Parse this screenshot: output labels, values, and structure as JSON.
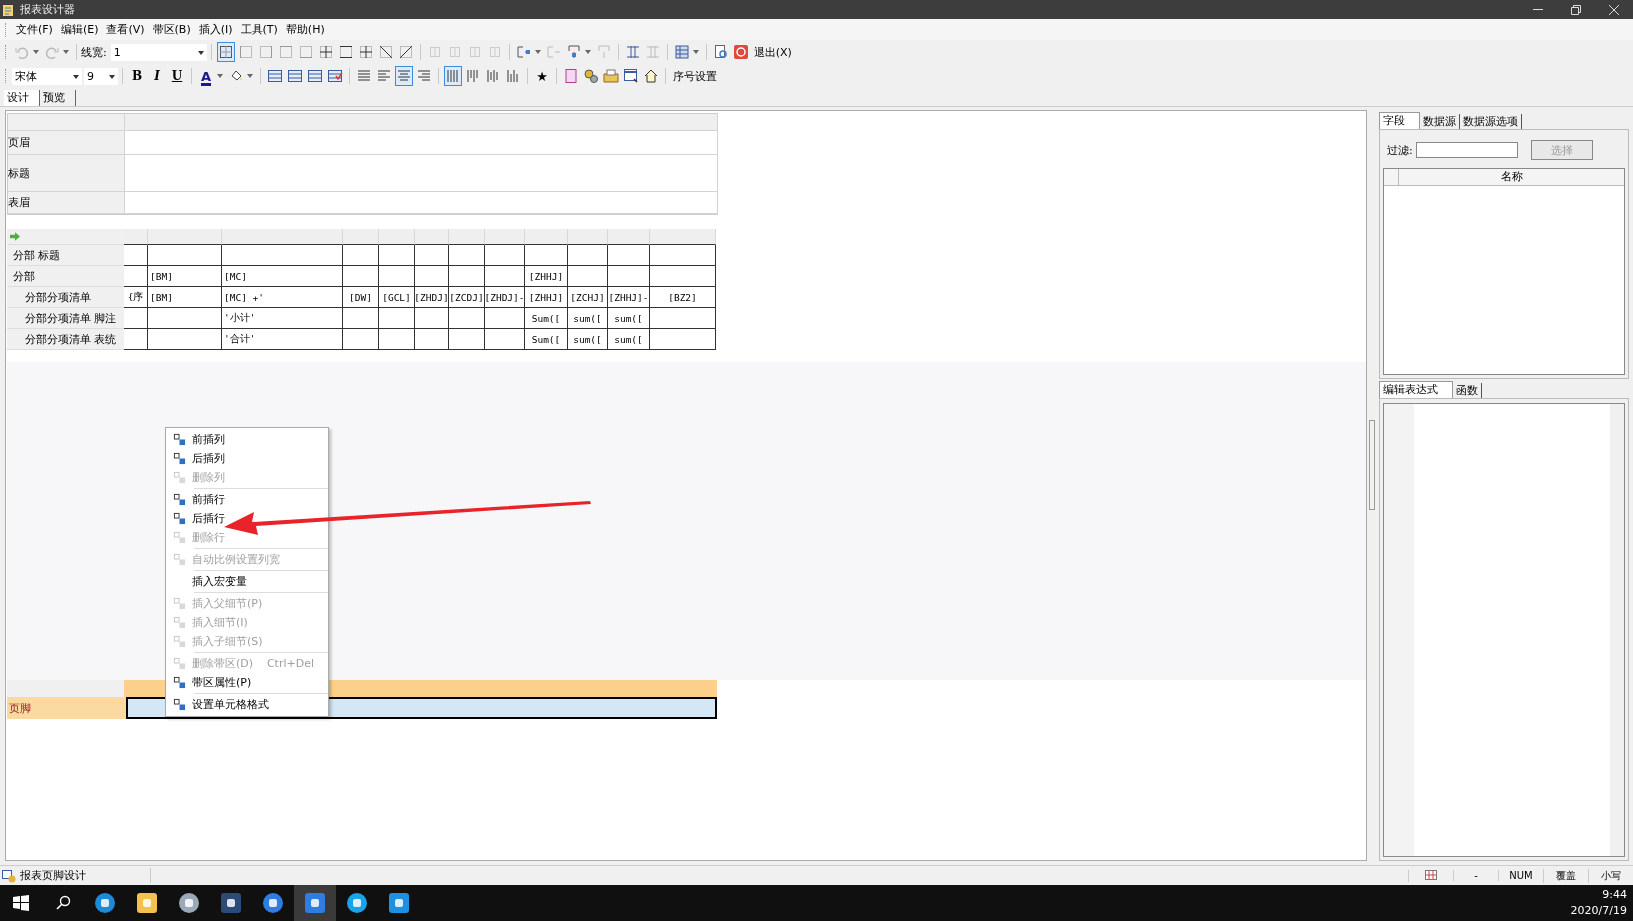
{
  "window": {
    "title": "报表设计器"
  },
  "menu": [
    "文件(F)",
    "编辑(E)",
    "查看(V)",
    "带区(B)",
    "插入(I)",
    "工具(T)",
    "帮助(H)"
  ],
  "toolbar_1": {
    "line_width": {
      "label": "线宽:",
      "value": "1"
    },
    "border_buttons": [
      {
        "selected": true
      },
      {
        "selected": false
      },
      {
        "selected": false
      },
      {
        "selected": false
      },
      {
        "selected": false
      },
      {
        "selected": false
      },
      {
        "selected": false
      },
      {
        "selected": false
      },
      {
        "selected": false
      },
      {
        "selected": false
      }
    ],
    "exit_button": "退出(X)"
  },
  "toolbar_2": {
    "font": "宋体",
    "size": "9",
    "format_buttons": [
      "B",
      "I",
      "U"
    ],
    "font_color_button": "A",
    "align_buttons": [
      {
        "selected": false
      },
      {
        "selected": false
      },
      {
        "selected": true
      },
      {
        "selected": false
      }
    ],
    "valign_buttons": [
      {
        "selected": true
      },
      {
        "selected": false
      },
      {
        "selected": false
      },
      {
        "selected": false
      }
    ],
    "star_button": "★",
    "sequence_button": "序号设置"
  },
  "view_tabs": [
    {
      "label": "设计",
      "selected": true
    },
    {
      "label": "预览",
      "selected": false
    }
  ],
  "top_bands": [
    {
      "label": "页眉"
    },
    {
      "label": "标题"
    },
    {
      "label": "表眉"
    }
  ],
  "detail_bands": [
    {
      "label": "分部 标题",
      "cells": [
        null,
        null,
        null,
        null,
        null,
        null,
        null,
        null,
        null,
        null,
        null,
        null
      ]
    },
    {
      "label": "分部",
      "cells": [
        null,
        "[BM]",
        "[MC]",
        null,
        null,
        null,
        null,
        null,
        "[ZHHJ]",
        null,
        null,
        null
      ],
      "children": [
        {
          "label": "分部分项清单",
          "cells": [
            "{序",
            "[BM]",
            "[MC] +'",
            "[DW]",
            "[GCL]",
            "[ZHDJ]",
            "[ZCDJ]",
            "[ZHDJ]-",
            "[ZHHJ]",
            "[ZCHJ]",
            "[ZHHJ]-",
            "[BZ2]"
          ]
        },
        {
          "label": "分部分项清单 脚注",
          "cells": [
            null,
            null,
            "'小计'",
            null,
            null,
            null,
            null,
            null,
            "Sum([",
            "sum([",
            "sum([",
            null
          ]
        },
        {
          "label": "分部分项清单 表统",
          "cells": [
            null,
            null,
            "'合计'",
            null,
            null,
            null,
            null,
            null,
            "Sum([",
            "sum([",
            "sum([",
            null
          ]
        }
      ]
    }
  ],
  "footer_band": {
    "label": "页脚",
    "selected": true
  },
  "context_menu": {
    "groups": [
      [
        {
          "kind": "icon",
          "label": "前插列",
          "disabled": false
        },
        {
          "kind": "icon",
          "label": "后插列",
          "disabled": false
        },
        {
          "kind": "icon",
          "label": "删除列",
          "disabled": true
        }
      ],
      [
        {
          "kind": "icon",
          "label": "前插行",
          "disabled": false
        },
        {
          "kind": "icon",
          "label": "后插行",
          "disabled": false
        },
        {
          "kind": "icon",
          "label": "删除行",
          "disabled": true
        }
      ],
      [
        {
          "kind": "icon",
          "label": "自动比例设置列宽",
          "disabled": true
        }
      ],
      [
        {
          "kind": "text",
          "label": "插入宏变量",
          "disabled": false
        }
      ],
      [
        {
          "kind": "icon",
          "label": "插入父细节(P)",
          "disabled": true
        },
        {
          "kind": "icon",
          "label": "插入细节(I)",
          "disabled": true
        },
        {
          "kind": "icon",
          "label": "插入子细节(S)",
          "disabled": true
        }
      ],
      [
        {
          "kind": "icon",
          "label": "删除带区(D)",
          "shortcut": "Ctrl+Del",
          "disabled": true
        },
        {
          "kind": "icon",
          "label": "带区属性(P)",
          "disabled": false
        }
      ],
      [
        {
          "kind": "icon",
          "label": "设置单元格格式",
          "disabled": false
        }
      ]
    ]
  },
  "right_panel": {
    "tabs": [
      {
        "label": "字段",
        "selected": true
      },
      {
        "label": "数据源",
        "selected": false
      },
      {
        "label": "数据源选项",
        "selected": false
      }
    ],
    "filter": {
      "label": "过滤:"
    },
    "select_button": {
      "label": "选择",
      "disabled": true
    },
    "list_header": "名称",
    "bottom_tabs": [
      {
        "label": "编辑表达式",
        "selected": true
      },
      {
        "label": "函数",
        "selected": false
      }
    ]
  },
  "status_bar": {
    "text": "报表页脚设计",
    "indicators": [
      "-",
      "NUM",
      "覆盖",
      "小写"
    ]
  },
  "taskbar": {
    "apps": [
      {
        "selected": false
      },
      {
        "selected": false
      },
      {
        "selected": false
      },
      {
        "selected": false
      },
      {
        "selected": false
      },
      {
        "selected": true
      },
      {
        "selected": false
      },
      {
        "selected": false
      }
    ],
    "time": "9:44",
    "date": "2020/7/19"
  }
}
